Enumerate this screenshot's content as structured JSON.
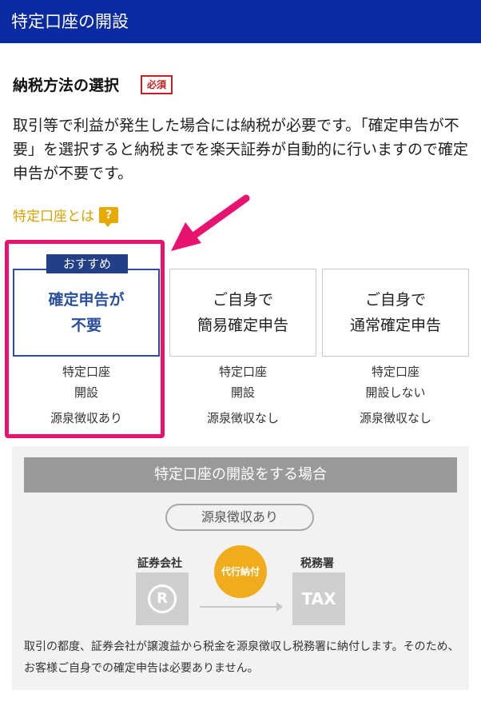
{
  "header": {
    "title": "特定口座の開設"
  },
  "section": {
    "title": "納税方法の選択",
    "required_badge": "必須",
    "description": "取引等で利益が発生した場合には納税が必要です。「確定申告が不要」を選択すると納税までを楽天証券が自動的に行いますので確定申告が不要です。",
    "help_link": "特定口座とは",
    "help_icon": "question-bubble-icon"
  },
  "options": [
    {
      "title_line1": "確定申告が",
      "title_line2": "不要",
      "info1": "特定口座",
      "info2": "開設",
      "info3": "源泉徴収あり",
      "badge": "おすすめ",
      "selected": true
    },
    {
      "title_line1": "ご自身で",
      "title_line2": "簡易確定申告",
      "info1": "特定口座",
      "info2": "開設",
      "info3": "源泉徴収なし",
      "selected": false
    },
    {
      "title_line1": "ご自身で",
      "title_line2": "通常確定申告",
      "info1": "特定口座",
      "info2": "開設しない",
      "info3": "源泉徴収なし",
      "selected": false
    }
  ],
  "panel": {
    "header": "特定口座の開設をする場合",
    "pill": "源泉徴収あり",
    "left_label": "証券会社",
    "left_icon_text": "R",
    "middle_label": "代行納付",
    "right_label": "税務署",
    "right_icon_text": "TAX",
    "note": "取引の都度、証券会社が譲渡益から税金を源泉徴収し税務署に納付します。そのため、お客様ご自身での確定申告は必要ありません。"
  },
  "colors": {
    "header_bg": "#0a2aa2",
    "accent_pink": "#e8136f",
    "selected_blue": "#2a4f9c",
    "link_gold": "#d9a000"
  }
}
